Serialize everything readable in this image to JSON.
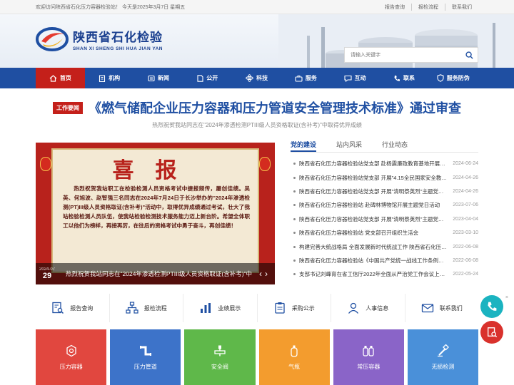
{
  "topbar": {
    "welcome": "欢迎访问陕西省石化压力容器检验站！ 今天是2025年3月7日 星期五",
    "links": [
      "报告查询",
      "报检流程",
      "联系我们"
    ]
  },
  "header": {
    "logo_cn": "陕西省石化检验",
    "logo_en": "SHAN XI SHENG SHI HUA JIAN YAN",
    "search_placeholder": "请输入关键字"
  },
  "nav": {
    "items": [
      {
        "label": "首页",
        "icon": "home-icon"
      },
      {
        "label": "机构",
        "icon": "building-icon"
      },
      {
        "label": "新闻",
        "icon": "news-icon"
      },
      {
        "label": "公开",
        "icon": "document-icon"
      },
      {
        "label": "科技",
        "icon": "atom-icon"
      },
      {
        "label": "服务",
        "icon": "briefcase-icon"
      },
      {
        "label": "互动",
        "icon": "chat-icon"
      },
      {
        "label": "联系",
        "icon": "phone-icon"
      },
      {
        "label": "服务防伪",
        "icon": "shield-icon"
      }
    ]
  },
  "headline": {
    "tag": "工作要闻",
    "title": "《燃气储配企业压力容器和压力管道安全管理技术标准》通过审查",
    "subtitle": "热烈祝贺我站同志在\"2024年渗透检测PTIII级人员资格取证(含补考)\"中取得优异成绩"
  },
  "banner": {
    "poster_title": "喜报",
    "poster_text": "热烈祝贺我站职工在检验检测人员资格考试中捷报频传，屡创佳绩。吴英、何旭波、赵智强三名同志在2024年7月24日于长沙举办的\"2024年渗透检测(PT)III级人员资格取证(含补考)\"活动中，取得优异成绩通过考试，壮大了我站检验检测人员队伍，使我站检验检测技术服务能力迈上新台阶。希望全体职工以他们为榜样，再接再厉，在往后的资格考试中勇于奋斗，再创佳绩！",
    "date_ym": "2024-07",
    "date_d": "29",
    "caption": "热烈祝贺我站同志在\"2024年渗透检测PTIII级人员资格取证(含补考)\"中取得优异成绩"
  },
  "news": {
    "tabs": [
      "党的建设",
      "站内风采",
      "行业动态"
    ],
    "items": [
      {
        "title": "陕西省石化压力容器检验站党支部 赴杨震廉政教育基地开展廉政主题党日活动",
        "date": "2024-06-24"
      },
      {
        "title": "陕西省石化压力容器检验站党支部 开展\"4.15全民国家安全教育日\"主题党日活动",
        "date": "2024-04-26"
      },
      {
        "title": "陕西省石化压力容器检验站党支部 开展\"清明祭英烈\"主题党日活动",
        "date": "2024-04-26"
      },
      {
        "title": "陕西省石化压力容器检验站 赴碑林博物馆开展主题党日活动",
        "date": "2023-07-06"
      },
      {
        "title": "陕西省石化压力容器检验站党支部 开展\"清明祭英烈\"主题党日活动",
        "date": "2023-04-04"
      },
      {
        "title": "陕西省石化压力容器检验站 党支部召开组织生活会",
        "date": "2023-03-10"
      },
      {
        "title": "构建完善大统战格局 全面发展新时代统战工作 陕西省石化压力容器检验站",
        "date": "2022-06-08"
      },
      {
        "title": "陕西省石化压力容器检验站《中国共产党统一战线工作条例》学习",
        "date": "2022-06-08"
      },
      {
        "title": "支部书记刘峰育在省工信厅2022年全面从严治党工作会议上的讲话",
        "date": "2022-05-24"
      }
    ]
  },
  "quick_links": [
    {
      "label": "报告查询",
      "icon": "report-search-icon"
    },
    {
      "label": "报检流程",
      "icon": "flowchart-icon"
    },
    {
      "label": "业绩展示",
      "icon": "bar-chart-icon"
    },
    {
      "label": "采购公示",
      "icon": "procurement-icon"
    },
    {
      "label": "人事信息",
      "icon": "person-icon"
    },
    {
      "label": "联系我们",
      "icon": "contact-icon"
    }
  ],
  "tiles": [
    {
      "label": "压力容器",
      "icon": "pressure-vessel-icon",
      "color": "#e1473f"
    },
    {
      "label": "压力管道",
      "icon": "pipe-icon",
      "color": "#3d73c9"
    },
    {
      "label": "安全阀",
      "icon": "safety-valve-icon",
      "color": "#5fb84a"
    },
    {
      "label": "气瓶",
      "icon": "gas-cylinder-icon",
      "color": "#f39c2e"
    },
    {
      "label": "常压容器",
      "icon": "atmospheric-vessel-icon",
      "color": "#8a64c8"
    },
    {
      "label": "无损检测",
      "icon": "ndt-icon",
      "color": "#4a90d9"
    }
  ],
  "colors": {
    "primary": "#1f4fa2",
    "accent": "#c4201a"
  }
}
